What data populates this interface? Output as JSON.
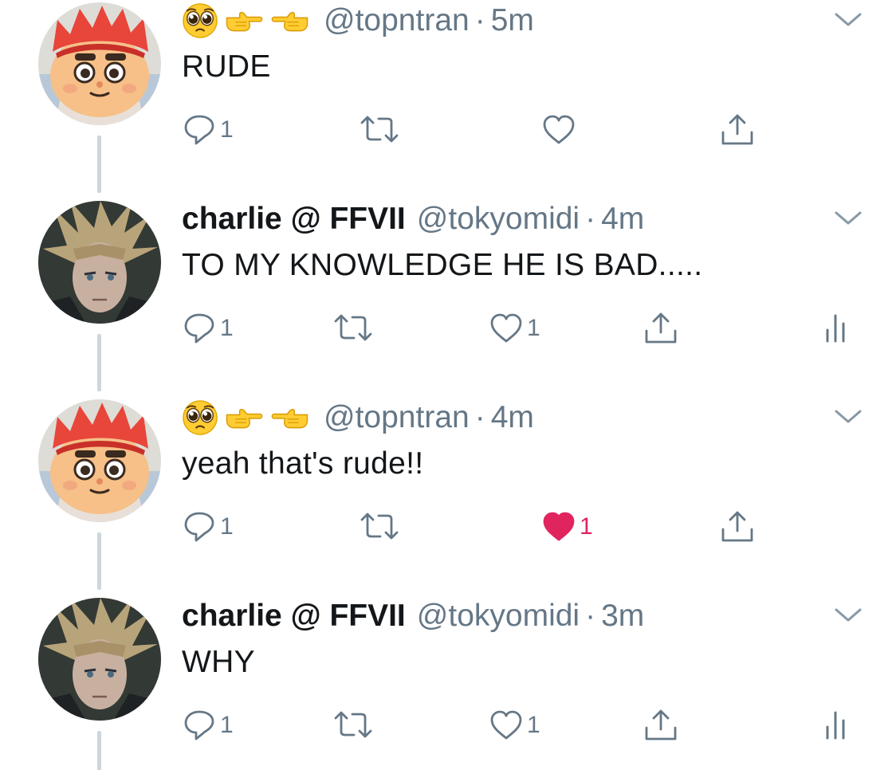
{
  "tweets": [
    {
      "display_name": "",
      "emojis": [
        "pleading-face",
        "backhand-index-pointing-right",
        "backhand-index-pointing-left"
      ],
      "handle": "@topntran",
      "separator": "·",
      "time": "5m",
      "text": "RUDE",
      "reply_count": "1",
      "retweet_count": "",
      "like_count": "",
      "liked": false,
      "show_analytics": false
    },
    {
      "display_name": "charlie @ FFVII",
      "emojis": [],
      "handle": "@tokyomidi",
      "separator": "·",
      "time": "4m",
      "text": "TO MY KNOWLEDGE HE IS BAD.....",
      "reply_count": "1",
      "retweet_count": "",
      "like_count": "1",
      "liked": false,
      "show_analytics": true
    },
    {
      "display_name": "",
      "emojis": [
        "pleading-face",
        "backhand-index-pointing-right",
        "backhand-index-pointing-left"
      ],
      "handle": "@topntran",
      "separator": "·",
      "time": "4m",
      "text": "yeah that's rude!!",
      "reply_count": "1",
      "retweet_count": "",
      "like_count": "1",
      "liked": true,
      "show_analytics": false
    },
    {
      "display_name": "charlie @ FFVII",
      "emojis": [],
      "handle": "@tokyomidi",
      "separator": "·",
      "time": "3m",
      "text": "WHY",
      "reply_count": "1",
      "retweet_count": "",
      "like_count": "1",
      "liked": false,
      "show_analytics": true
    }
  ],
  "colors": {
    "text": "#14171a",
    "secondary": "#657786",
    "icon": "#657786",
    "like_active": "#e0245e",
    "thread_line": "#ccd6dd"
  },
  "icons": {
    "reply": "reply-icon",
    "retweet": "retweet-icon",
    "like": "heart-icon",
    "share": "share-icon",
    "analytics": "analytics-icon",
    "menu": "chevron-down-icon"
  }
}
